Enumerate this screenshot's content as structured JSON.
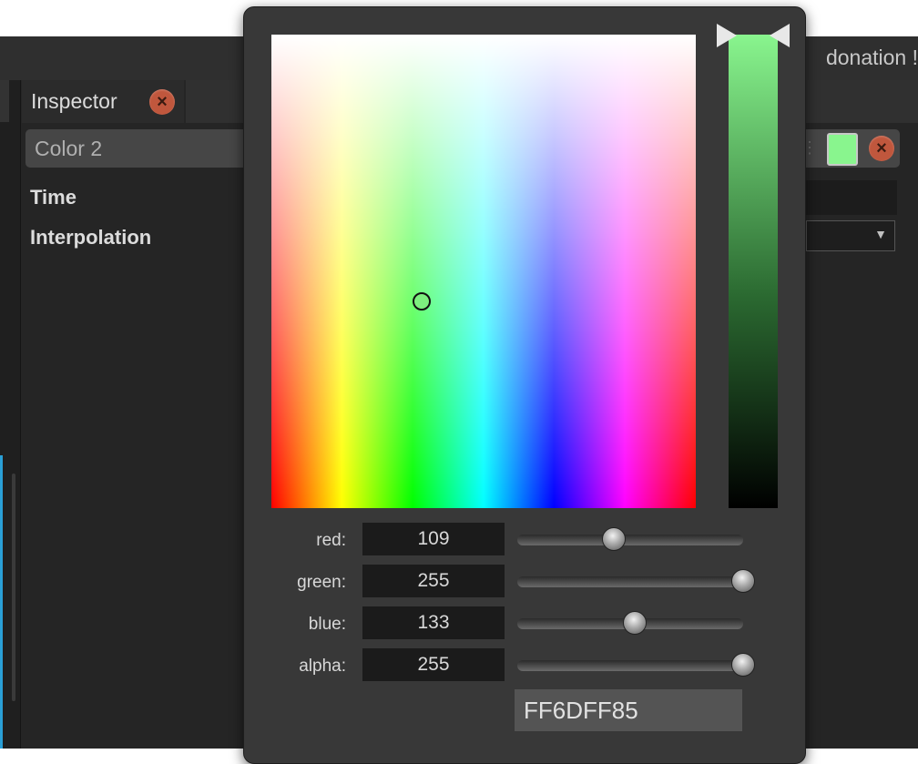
{
  "topbar": {
    "donation_text": "donation !"
  },
  "inspector": {
    "tab_label": "Inspector",
    "close_icon": "close-icon",
    "color_name": "Color 2",
    "swatch_color": "#89f58e",
    "properties": [
      {
        "label": "Time"
      },
      {
        "label": "Interpolation"
      }
    ]
  },
  "color_picker": {
    "channels": [
      {
        "label": "red:",
        "value": "109",
        "fraction": 0.427
      },
      {
        "label": "green:",
        "value": "255",
        "fraction": 1.0
      },
      {
        "label": "blue:",
        "value": "133",
        "fraction": 0.522
      },
      {
        "label": "alpha:",
        "value": "255",
        "fraction": 1.0
      }
    ],
    "hex_value": "FF6DFF85"
  }
}
